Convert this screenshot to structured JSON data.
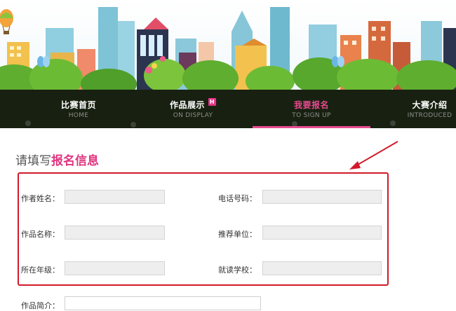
{
  "nav": {
    "items": [
      {
        "cn": "比赛首页",
        "en": "HOME"
      },
      {
        "cn": "作品展示",
        "en": "ON DISPLAY",
        "badge": "H"
      },
      {
        "cn": "我要报名",
        "en": "TO SIGN UP"
      },
      {
        "cn": "大赛介绍",
        "en": "INTRODUCED"
      }
    ],
    "active_index": 2
  },
  "section": {
    "title_prefix": "请填写",
    "title_highlight": "报名信息"
  },
  "form": {
    "author_name_label": "作者姓名：",
    "phone_label": "电话号码：",
    "work_name_label": "作品名称：",
    "recommend_unit_label": "推荐单位：",
    "grade_label": "所在年级：",
    "school_label": "就读学校：",
    "intro_label": "作品简介："
  },
  "colors": {
    "accent": "#e0357e",
    "highlight_box": "#d11a2a",
    "nav_bg": "#12160e"
  }
}
